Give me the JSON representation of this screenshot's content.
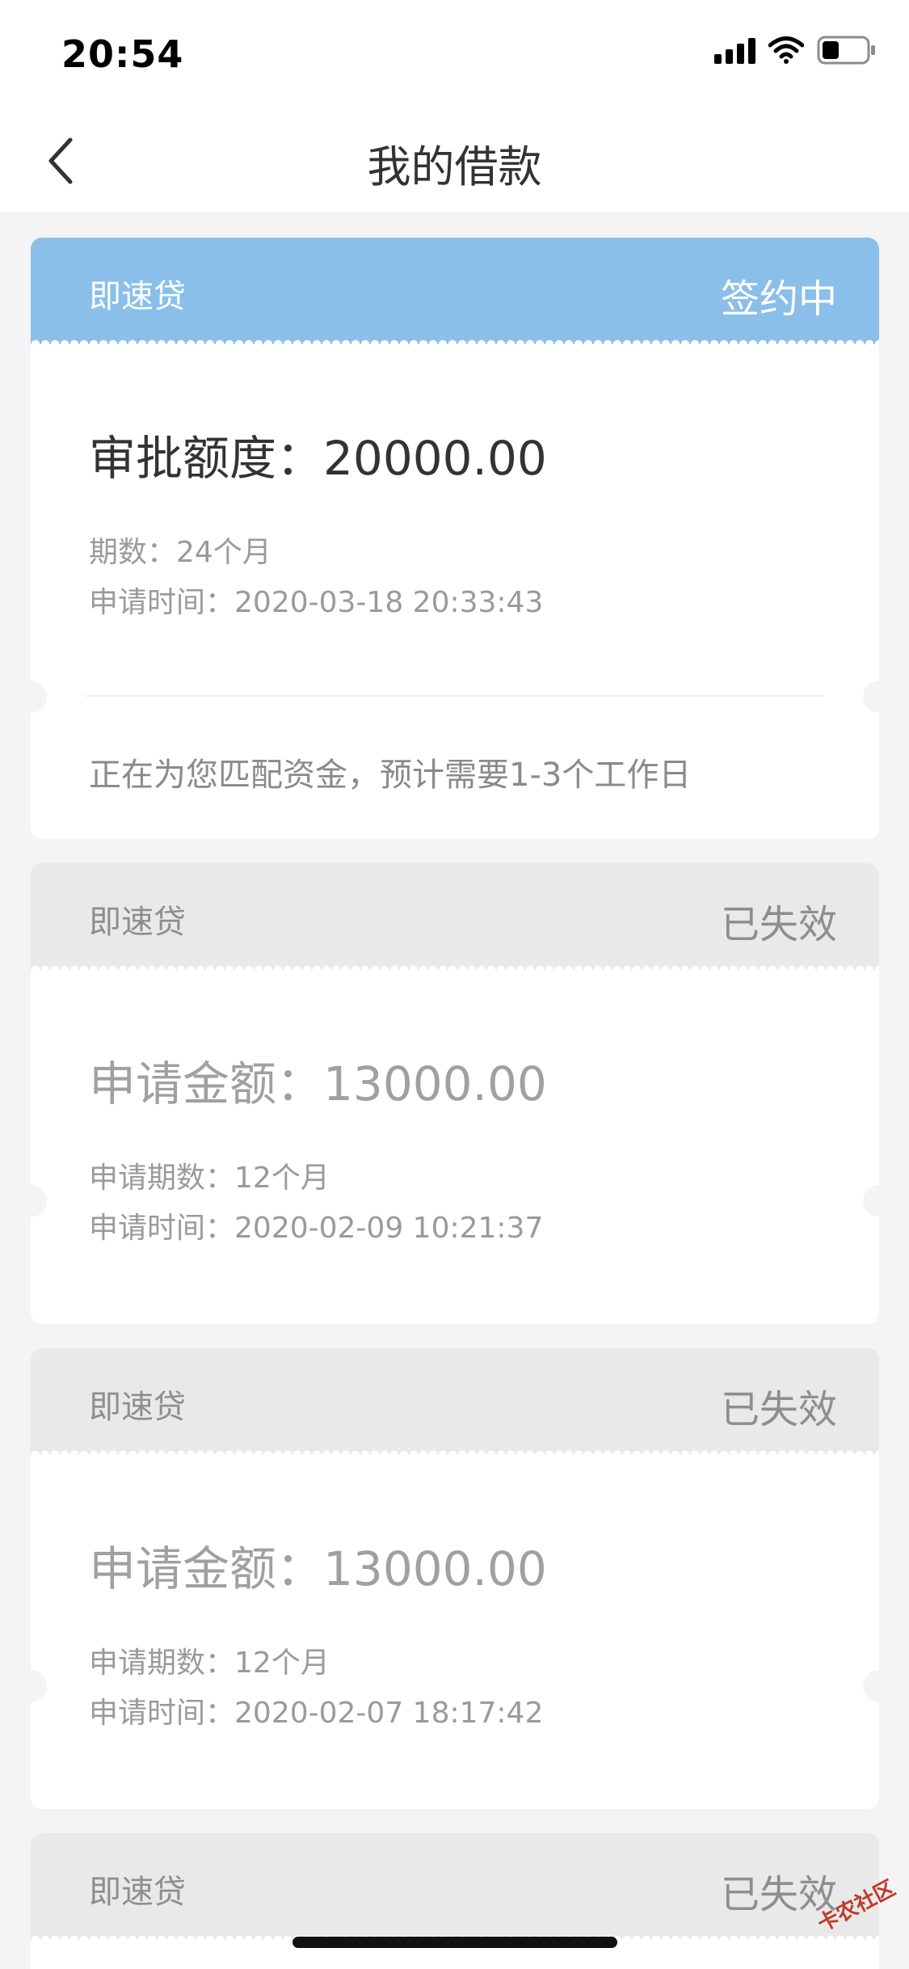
{
  "status_bar": {
    "time": "20:54"
  },
  "nav": {
    "title": "我的借款"
  },
  "loans": [
    {
      "product": "即速贷",
      "status": "签约中",
      "amount_label": "审批额度：",
      "amount": "20000.00",
      "term_label": "期数：",
      "term": "24个月",
      "time_label": "申请时间：",
      "time": "2020-03-18 20:33:43",
      "notice": "正在为您匹配资金，预计需要1-3个工作日"
    },
    {
      "product": "即速贷",
      "status": "已失效",
      "amount_label": "申请金额：",
      "amount": "13000.00",
      "term_label": "申请期数：",
      "term": "12个月",
      "time_label": "申请时间：",
      "time": "2020-02-09 10:21:37"
    },
    {
      "product": "即速贷",
      "status": "已失效",
      "amount_label": "申请金额：",
      "amount": "13000.00",
      "term_label": "申请期数：",
      "term": "12个月",
      "time_label": "申请时间：",
      "time": "2020-02-07 18:17:42"
    },
    {
      "product": "即速贷",
      "status": "已失效"
    }
  ],
  "watermark": "卡农社区",
  "colors": {
    "active_header": "#8abfea",
    "inactive_header": "#e9e9e9",
    "background": "#f4f4f4"
  }
}
